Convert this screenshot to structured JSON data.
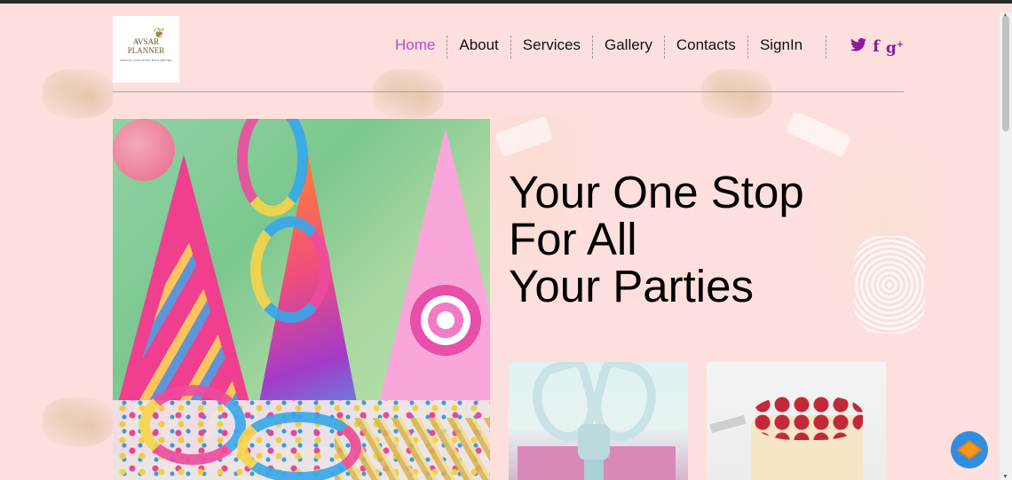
{
  "logo": {
    "line1": "AVSAR",
    "line2": "PLANNER",
    "tagline": "MAKING YOUR GOOD DAYS BETTER"
  },
  "nav": {
    "items": [
      {
        "label": "Home",
        "active": true
      },
      {
        "label": "About",
        "active": false
      },
      {
        "label": "Services",
        "active": false
      },
      {
        "label": "Gallery",
        "active": false
      },
      {
        "label": "Contacts",
        "active": false
      },
      {
        "label": "SignIn",
        "active": false
      }
    ],
    "active_color": "#b94dbf"
  },
  "social": {
    "color": "#8b1a9c",
    "icons": [
      "twitter-icon",
      "facebook-icon",
      "google-plus-icon"
    ],
    "twitter": "🐦",
    "facebook": "f",
    "googleplus": "g",
    "googleplus_sup": "+"
  },
  "hero": {
    "headline_lines": [
      "Your One Stop",
      "For All",
      "Your Parties"
    ],
    "image": "party-hats-ribbons-image"
  },
  "cards": [
    {
      "name": "gift-card",
      "image": "gift-box-image"
    },
    {
      "name": "cake-card",
      "image": "raspberry-cake-image"
    }
  ],
  "theme": {
    "background": "#fde0dd",
    "topbar": "#2b2b2b"
  },
  "chat": {
    "icon": "chat-cube-icon",
    "color": "#2f8ee0"
  }
}
